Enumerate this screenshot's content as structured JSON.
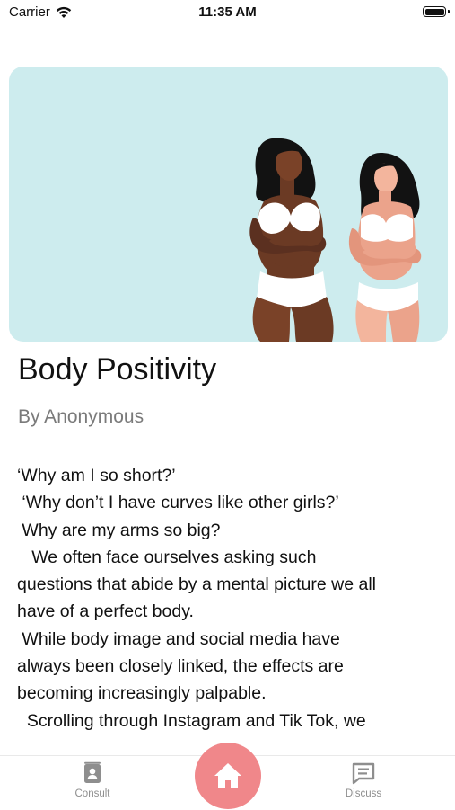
{
  "status_bar": {
    "carrier": "Carrier",
    "time": "11:35 AM",
    "wifi_icon": "wifi-icon",
    "battery_icon": "battery-icon"
  },
  "hero": {
    "image_icon": "two-women-illustration",
    "background_color": "#cdecee"
  },
  "article": {
    "title": "Body Positivity",
    "author": "By Anonymous",
    "paragraphs": [
      "‘Why am I so short?’",
      " ‘Why don’t I have curves like other girls?’",
      " Why are my arms so big?",
      "   We often face ourselves asking such",
      "questions that abide by a mental picture we all",
      "have of a perfect body.",
      " While body image and social media have",
      "always been closely linked, the effects are",
      "becoming increasingly palpable.",
      "  Scrolling through Instagram and Tik Tok, we"
    ]
  },
  "tab_bar": {
    "consult_label": "Consult",
    "consult_icon": "contact-book-icon",
    "home_icon": "home-icon",
    "discuss_label": "Discuss",
    "discuss_icon": "chat-bubble-icon",
    "home_color": "#f0878a"
  }
}
